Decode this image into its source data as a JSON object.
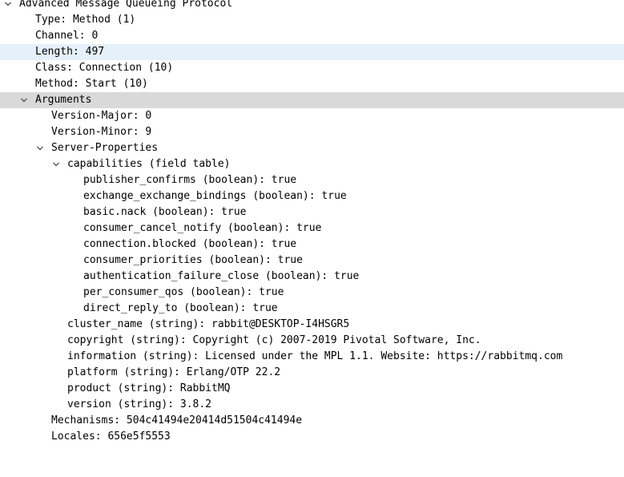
{
  "tree": {
    "root": "Advanced Message Queueing Protocol",
    "type": "Type: Method (1)",
    "channel": "Channel: 0",
    "length": "Length: 497",
    "class": "Class: Connection (10)",
    "method": "Method: Start (10)",
    "arguments": "Arguments",
    "version_major": "Version-Major: 0",
    "version_minor": "Version-Minor: 9",
    "server_properties": "Server-Properties",
    "capabilities": "capabilities (field table)",
    "cap_items": [
      "publisher_confirms (boolean): true",
      "exchange_exchange_bindings (boolean): true",
      "basic.nack (boolean): true",
      "consumer_cancel_notify (boolean): true",
      "connection.blocked (boolean): true",
      "consumer_priorities (boolean): true",
      "authentication_failure_close (boolean): true",
      "per_consumer_qos (boolean): true",
      "direct_reply_to (boolean): true"
    ],
    "cluster_name": "cluster_name (string): rabbit@DESKTOP-I4HSGR5",
    "copyright": "copyright (string): Copyright (c) 2007-2019 Pivotal Software, Inc.",
    "information": "information (string): Licensed under the MPL 1.1. Website: https://rabbitmq.com",
    "platform": "platform (string): Erlang/OTP 22.2",
    "product": "product (string): RabbitMQ",
    "version": "version (string): 3.8.2",
    "mechanisms": "Mechanisms: 504c41494e20414d51504c41494e",
    "locales": "Locales: 656e5f5553"
  },
  "icons": {
    "expand": "chevron-down-icon"
  },
  "colors": {
    "selected_row": "#e6f0fb",
    "focused_row": "#d9d9d9",
    "toggle": "#555555"
  }
}
